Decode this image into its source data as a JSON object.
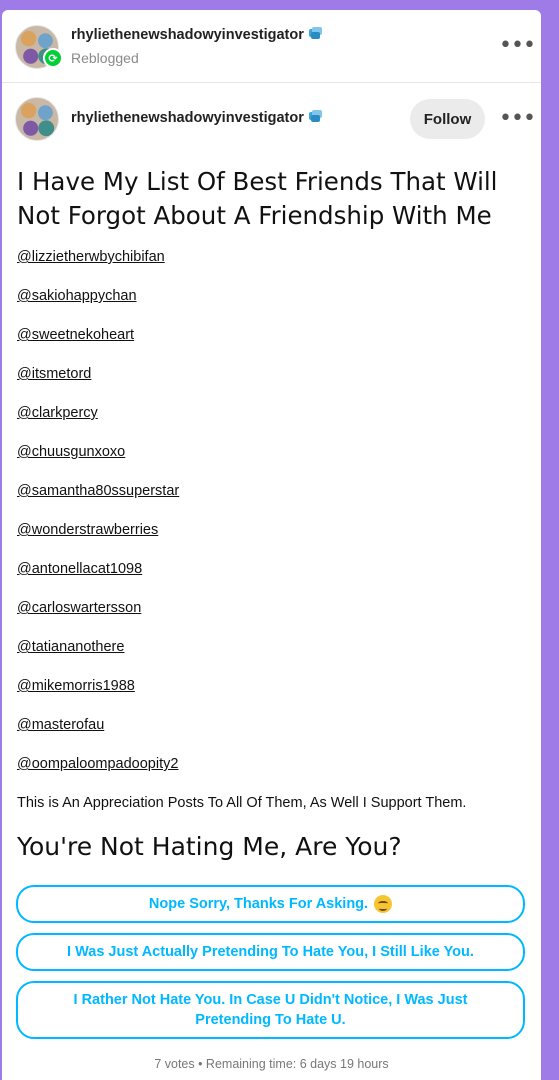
{
  "reblog_header": {
    "username": "rhyliethenewshadowyinvestigator",
    "status": "Reblogged",
    "more_label": "•••"
  },
  "post_header": {
    "username": "rhyliethenewshadowyinvestigator",
    "follow_label": "Follow",
    "more_label": "•••"
  },
  "post": {
    "title": "I Have My List Of Best Friends That Will Not Forgot About A Friendship With Me",
    "mentions": [
      "@lizzietherwbychibifan",
      "@sakiohappychan",
      "@sweetnekoheart",
      "@itsmetord",
      "@clarkpercy",
      "@chuusgunxoxo",
      "@samantha80ssuperstar",
      "@wonderstrawberries",
      "@antonellacat1098",
      "@carloswartersson",
      "@tatiananothere",
      "@mikemorris1988",
      "@masterofau",
      "@oompaloompadoopity2"
    ],
    "appreciation": "This is An Appreciation Posts To All Of Them, As Well I Support Them."
  },
  "poll": {
    "question": "You're Not Hating Me, Are You?",
    "options": [
      "Nope Sorry, Thanks For Asking.",
      "I Was Just Actually Pretending To Hate You, I Still Like You.",
      "I Rather Not Hate You. In Case U Didn't Notice, I Was Just Pretending To Hate U."
    ],
    "footer": "7 votes • Remaining time: 6 days 19 hours"
  },
  "colors": {
    "background": "#9f7be8",
    "poll_accent": "#00b8ff",
    "reblog_badge": "#00cf35",
    "verified_badge": "#3aa6d9"
  },
  "icons": {
    "reblog_badge": "reblog-icon",
    "verified": "verified-badge-icon",
    "more": "more-options-icon",
    "emoji": "smirking-face-emoji"
  }
}
